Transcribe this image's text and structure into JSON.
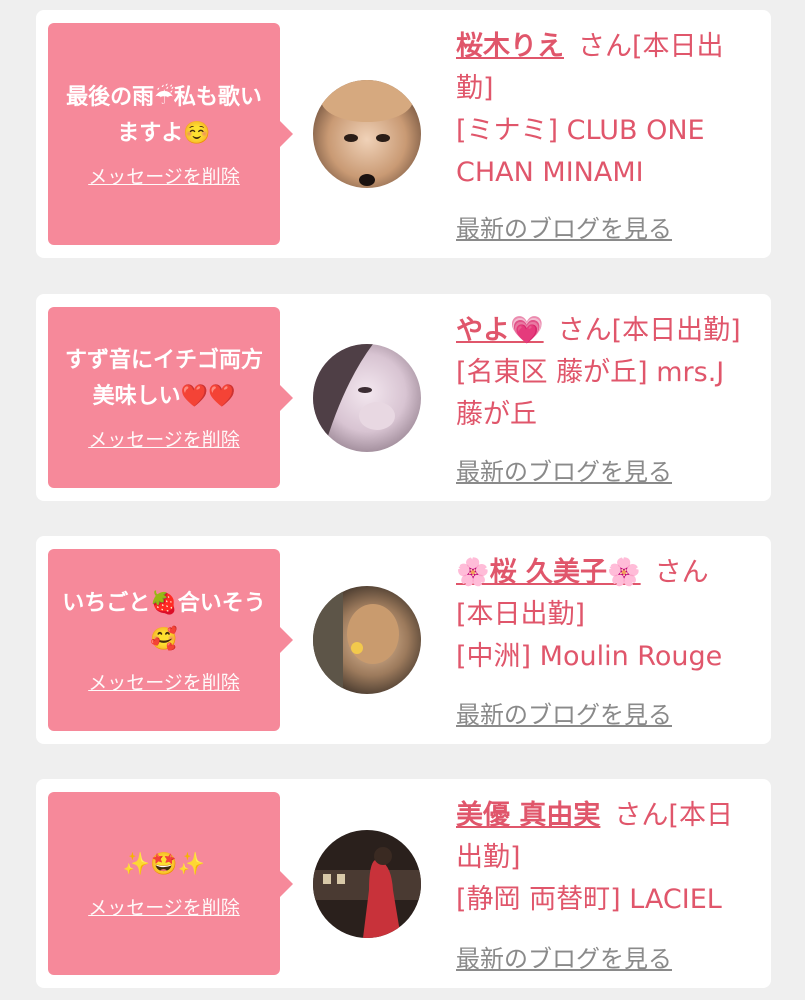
{
  "delete_label": "メッセージを削除",
  "blog_label": "最新のブログを見る",
  "san_label": "さん",
  "cards": [
    {
      "message": "最後の雨☔私も歌いますよ☺️",
      "name": "桜木りえ",
      "status": "[本日出勤]",
      "area_club": "[ミナミ] CLUB ONE CHAN MINAMI",
      "avatar_palette": [
        "#c59a78",
        "#e8c6a8",
        "#3a2a20"
      ]
    },
    {
      "message": "すず音にイチゴ両方美味しい❤️❤️",
      "name": "やよ💗",
      "status": "[本日出勤]",
      "area_club": "[名東区 藤が丘] mrs.J 藤が丘",
      "avatar_palette": [
        "#d9c9d6",
        "#f1e6ee",
        "#5a4a54"
      ]
    },
    {
      "message": "いちごと🍓合いそう🥰",
      "name": "🌸桜 久美子🌸",
      "status": "[本日出勤]",
      "area_club": "[中洲] Moulin Rouge",
      "avatar_palette": [
        "#7a6a58",
        "#d9b08a",
        "#2b2520"
      ]
    },
    {
      "message": "✨🤩✨",
      "name": "美優 真由実",
      "status": "[本日出勤]",
      "area_club": "[静岡 両替町] LACIEL",
      "avatar_palette": [
        "#3a2b26",
        "#c83a3a",
        "#1b1512"
      ]
    }
  ]
}
